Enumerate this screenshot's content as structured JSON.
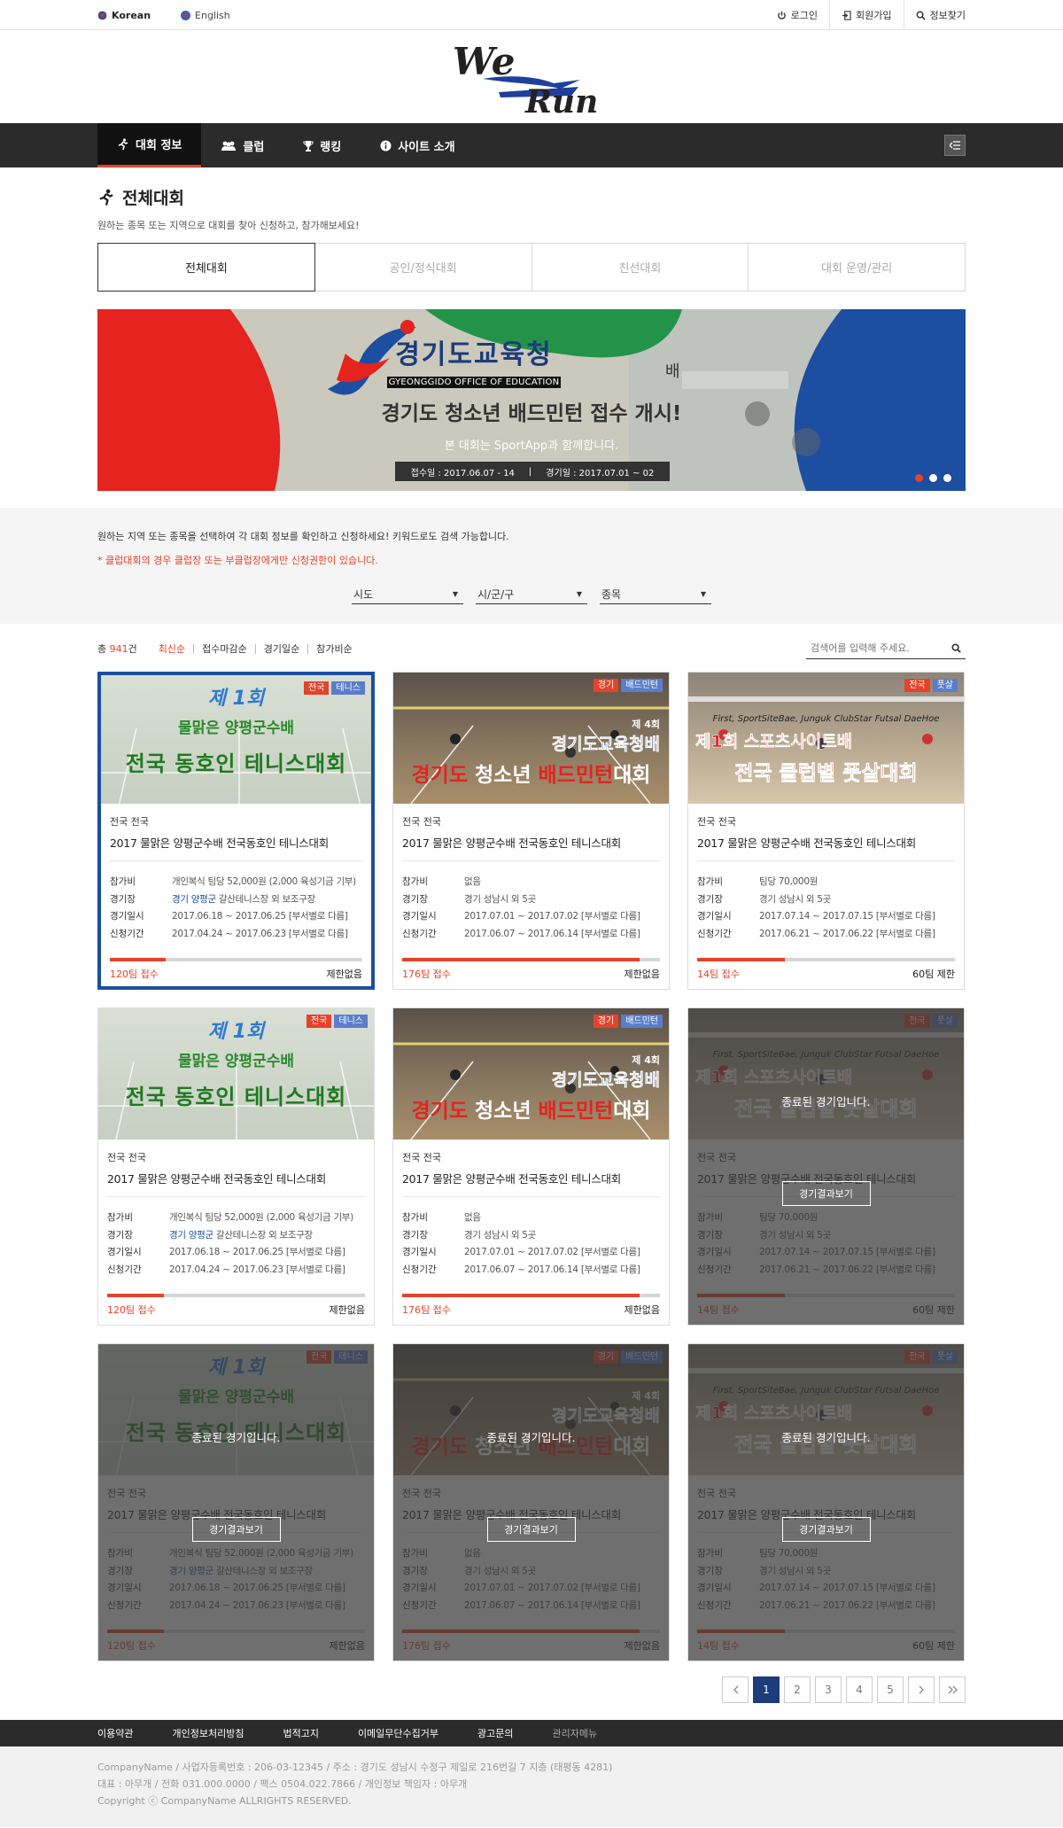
{
  "topbar": {
    "langs": [
      {
        "label": "Korean"
      },
      {
        "label": "English"
      }
    ],
    "util": {
      "login": "로그인",
      "join": "회원가입",
      "find": "정보찾기"
    }
  },
  "logo": {
    "text_top": "We",
    "text_bottom": "Run"
  },
  "gnb": {
    "items": [
      {
        "label": "대회 정보"
      },
      {
        "label": "클럽"
      },
      {
        "label": "랭킹"
      },
      {
        "label": "사이트 소개"
      }
    ]
  },
  "page": {
    "title": "전체대회",
    "desc": "원하는 종목 또는 지역으로 대회를 찾아 신청하고, 참가해보세요!",
    "tabs": [
      {
        "label": "전체대회"
      },
      {
        "label": "공인/정식대회"
      },
      {
        "label": "친선대회"
      },
      {
        "label": "대회 운영/관리"
      }
    ]
  },
  "banner": {
    "org": "경기도교육청",
    "org_en": "GYEONGGIDO OFFICE OF EDUCATION",
    "suffix": "배",
    "headline": "경기도 청소년 배드민턴 접수 개시!",
    "sub": "본 대회는 SportApp과 함께합니다.",
    "period_reg": "접수일 : 2017.06.07 - 14",
    "period_game": "경기일 : 2017.07.01 ~ 02"
  },
  "filter": {
    "desc": "원하는 지역 또는 종목을 선택하여 각 대회 정보를 확인하고 신청하세요! 키워드로도 검색 가능합니다.",
    "note": "* 클럽대회의 경우 클럽장 또는 부클럽장에게만 신청권한이 있습니다.",
    "selects": [
      {
        "label": "시도"
      },
      {
        "label": "시/군/구"
      },
      {
        "label": "종목"
      }
    ]
  },
  "list": {
    "total_prefix": "총",
    "total_count": "941",
    "total_suffix": "건",
    "sorts": [
      {
        "label": "최신순"
      },
      {
        "label": "접수마감순"
      },
      {
        "label": "경기일순"
      },
      {
        "label": "참가비순"
      }
    ],
    "search_placeholder": "검색어를 입력해 주세요."
  },
  "labels": {
    "fee": "참가비",
    "venue": "경기장",
    "date": "경기일시",
    "period": "신청기간",
    "ended": "종료된 경기입니다.",
    "result": "경기결과보기"
  },
  "cards": [
    {
      "tags": [
        "전국",
        "테니스"
      ],
      "thumb": "tennis",
      "region": "전국 전국",
      "title": "2017 물맑은 양평군수배 전국동호인 테니스대회",
      "fee": "개인복식 팀당 52,000원 (2,000 육성기금 기부)",
      "venue_hl": "경기 양평군",
      "venue": " 갈산테니스장 외 보조구장",
      "date": "2017.06.18 ~ 2017.06.25 [부서별로 다름]",
      "period": "2017.04.24 ~ 2017.06.23 [부서별로 다름]",
      "count": "120팀 접수",
      "limit": "제한없음",
      "progress": 0.22,
      "ended": false
    },
    {
      "tags": [
        "경기",
        "배드민턴"
      ],
      "thumb": "badminton",
      "region": "전국 전국",
      "title": "2017 물맑은 양평군수배 전국동호인 테니스대회",
      "fee": "없음",
      "venue_hl": "",
      "venue": "경기 성남시 외 5곳",
      "date": "2017.07.01 ~ 2017.07.02 [부서별로 다름]",
      "period": "2017.06.07 ~ 2017.06.14 [부서별로 다름]",
      "count": "176팀 접수",
      "limit": "제한없음",
      "progress": 0.92,
      "ended": false
    },
    {
      "tags": [
        "전국",
        "풋살"
      ],
      "thumb": "futsal",
      "region": "전국 전국",
      "title": "2017 물맑은 양평군수배 전국동호인 테니스대회",
      "fee": "팀당 70,000원",
      "venue_hl": "",
      "venue": "경기 성남시 외 5곳",
      "date": "2017.07.14 ~ 2017.07.15 [부서별로 다름]",
      "period": "2017.06.21 ~ 2017.06.22 [부서별로 다름]",
      "count": "14팀 접수",
      "limit": "60팀 제한",
      "progress": 0.34,
      "ended": false
    },
    {
      "tags": [
        "전국",
        "테니스"
      ],
      "thumb": "tennis",
      "region": "전국 전국",
      "title": "2017 물맑은 양평군수배 전국동호인 테니스대회",
      "fee": "개인복식 팀당 52,000원 (2,000 육성기금 기부)",
      "venue_hl": "경기 양평군",
      "venue": " 갈산테니스장 외 보조구장",
      "date": "2017.06.18 ~ 2017.06.25 [부서별로 다름]",
      "period": "2017.04.24 ~ 2017.06.23 [부서별로 다름]",
      "count": "120팀 접수",
      "limit": "제한없음",
      "progress": 0.22,
      "ended": false
    },
    {
      "tags": [
        "경기",
        "배드민턴"
      ],
      "thumb": "badminton",
      "region": "전국 전국",
      "title": "2017 물맑은 양평군수배 전국동호인 테니스대회",
      "fee": "없음",
      "venue_hl": "",
      "venue": "경기 성남시 외 5곳",
      "date": "2017.07.01 ~ 2017.07.02 [부서별로 다름]",
      "period": "2017.06.07 ~ 2017.06.14 [부서별로 다름]",
      "count": "176팀 접수",
      "limit": "제한없음",
      "progress": 0.92,
      "ended": false
    },
    {
      "tags": [
        "전국",
        "풋살"
      ],
      "thumb": "futsal",
      "region": "전국 전국",
      "title": "2017 물맑은 양평군수배 전국동호인 테니스대회",
      "fee": "팀당 70,000원",
      "venue_hl": "",
      "venue": "경기 성남시 외 5곳",
      "date": "2017.07.14 ~ 2017.07.15 [부서별로 다름]",
      "period": "2017.06.21 ~ 2017.06.22 [부서별로 다름]",
      "count": "14팀 접수",
      "limit": "60팀 제한",
      "progress": 0.34,
      "ended": true
    },
    {
      "tags": [
        "전국",
        "테니스"
      ],
      "thumb": "tennis",
      "region": "전국 전국",
      "title": "2017 물맑은 양평군수배 전국동호인 테니스대회",
      "fee": "개인복식 팀당 52,000원 (2,000 육성기금 기부)",
      "venue_hl": "경기 양평군",
      "venue": " 갈산테니스장 외 보조구장",
      "date": "2017.06.18 ~ 2017.06.25 [부서별로 다름]",
      "period": "2017.04.24 ~ 2017.06.23 [부서별로 다름]",
      "count": "120팀 접수",
      "limit": "제한없음",
      "progress": 0.22,
      "ended": true
    },
    {
      "tags": [
        "경기",
        "배드민턴"
      ],
      "thumb": "badminton",
      "region": "전국 전국",
      "title": "2017 물맑은 양평군수배 전국동호인 테니스대회",
      "fee": "없음",
      "venue_hl": "",
      "venue": "경기 성남시 외 5곳",
      "date": "2017.07.01 ~ 2017.07.02 [부서별로 다름]",
      "period": "2017.06.07 ~ 2017.06.14 [부서별로 다름]",
      "count": "176팀 접수",
      "limit": "제한없음",
      "progress": 0.92,
      "ended": true
    },
    {
      "tags": [
        "전국",
        "풋살"
      ],
      "thumb": "futsal",
      "region": "전국 전국",
      "title": "2017 물맑은 양평군수배 전국동호인 테니스대회",
      "fee": "팀당 70,000원",
      "venue_hl": "",
      "venue": "경기 성남시 외 5곳",
      "date": "2017.07.14 ~ 2017.07.15 [부서별로 다름]",
      "period": "2017.06.21 ~ 2017.06.22 [부서별로 다름]",
      "count": "14팀 접수",
      "limit": "60팀 제한",
      "progress": 0.34,
      "ended": true
    }
  ],
  "thumbs": {
    "tennis": {
      "line1": "제 1회",
      "line2": "물맑은 양평군수배",
      "line3": "전국 동호인 테니스대회"
    },
    "badminton": {
      "no": "제 4회",
      "line1": "경기도교육청배",
      "line2a": "경기도",
      "line2b": " 청소년 ",
      "line2c": "배드민턴",
      "line2d": "대회"
    },
    "futsal": {
      "en": "First, SportSiteBae, Junguk ClubStar Futsal DaeHoe",
      "line1": "제1회 스포츠사이트배",
      "line2": "전국 클럽별 풋살대회"
    }
  },
  "paging": {
    "pages": [
      "1",
      "2",
      "3",
      "4",
      "5"
    ],
    "current": "1"
  },
  "footer": {
    "nav": [
      {
        "label": "이용약관"
      },
      {
        "label": "개인정보처리방침"
      },
      {
        "label": "법적고지"
      },
      {
        "label": "이메일무단수집거부"
      },
      {
        "label": "광고문의"
      },
      {
        "label": "관리자메뉴"
      }
    ],
    "line1": "CompanyName / 사업자등록번호 : 206-03-12345 / 주소 : 경기도 성남시 수정구 제일로 216번길 7 지층 (태평동 4281)",
    "line2": "대표 : 아무개 / 전화 031.000.0000 / 팩스 0504.022.7866 / 개인정보 책임자 : 아무개",
    "line3": "Copyright ⓒ CompanyName ALLRIGHTS RESERVED."
  },
  "colors": {
    "accent": "#e5422b",
    "navy": "#1c4fa1",
    "gnb": "#2b2b2b"
  }
}
